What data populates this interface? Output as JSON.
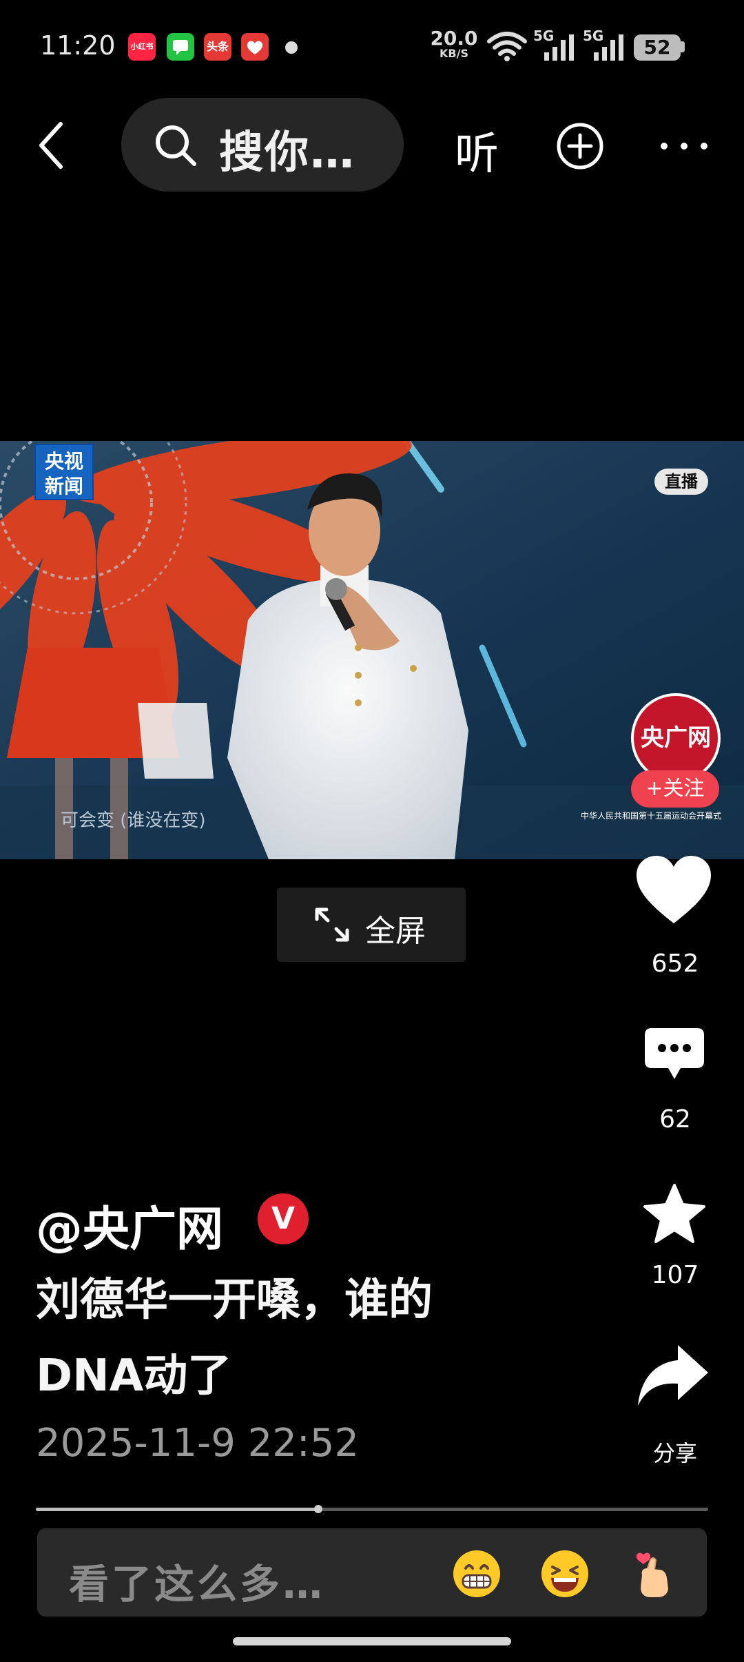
{
  "status_bar": {
    "time": "11:20",
    "app_badges": [
      {
        "label": "小红书",
        "color": "#ff2442"
      },
      {
        "label": "",
        "color": "#23c343"
      },
      {
        "label": "头条",
        "color": "#e53935"
      },
      {
        "label": "",
        "color": "#e53935"
      }
    ],
    "net_speed_value": "20.0",
    "net_speed_unit": "KB/S",
    "signal_label_1": "5G",
    "signal_label_2": "5G",
    "battery": "52"
  },
  "top_nav": {
    "back_icon": "chevron-left-icon",
    "search_placeholder": "搜你…",
    "listen_label": "听",
    "add_icon": "plus-circle-icon",
    "more_icon": "more-horizontal-icon"
  },
  "video": {
    "channel_logo": "央视\n新闻",
    "live_badge": "直播",
    "subtitle": "可会变 (谁没在变)",
    "event_caption": "中华人民共和国第十五届运动会开幕式"
  },
  "author_avatar": {
    "label": "央广网",
    "follow_label": "+关注"
  },
  "fullscreen_label": "全屏",
  "actions": {
    "likes": "652",
    "comments": "62",
    "favorites": "107",
    "share_label": "分享"
  },
  "post": {
    "author": "@央广网",
    "verified_mark": "V",
    "caption_line1": "刘德华一开嗓，谁的",
    "caption_line2": "DNA动了",
    "date": "2025-11-9 22:52"
  },
  "progress": {
    "fraction": 0.42
  },
  "comment_bar": {
    "placeholder": "看了这么多…",
    "emojis": [
      "grinning-face-icon",
      "laughing-face-icon",
      "finger-heart-icon"
    ]
  },
  "colors": {
    "background": "#000000",
    "accent_red": "#f0414e",
    "verified_red": "#e0202e"
  }
}
